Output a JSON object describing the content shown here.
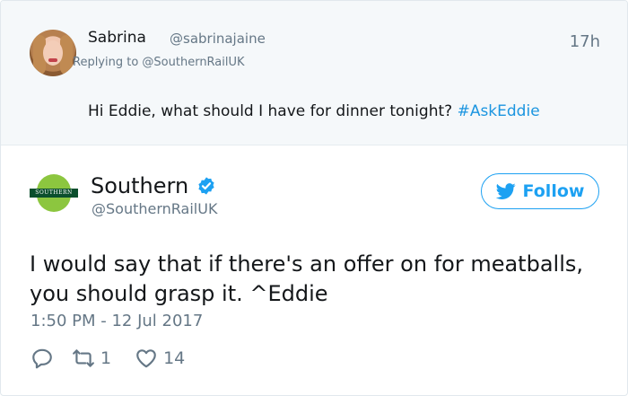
{
  "reply": {
    "name": "Sabrina",
    "handle": "@sabrinajaine",
    "time": "17h",
    "replying_to": "Replying to @SouthernRailUK",
    "text": "Hi Eddie, what should I have for dinner tonight?",
    "hashtag": "#AskEddie"
  },
  "tweet": {
    "logo_text": "SOUTHERN",
    "author_name": "Southern",
    "author_handle": "@SouthernRailUK",
    "follow_label": "Follow",
    "text": "I would say that if there's an offer on for meatballs, you should grasp it. ^Eddie",
    "timestamp": "1:50 PM - 12 Jul 2017",
    "retweet_count": "1",
    "like_count": "14"
  },
  "colors": {
    "accent": "#1da1f2",
    "hashtag": "#1b95e0",
    "muted": "#657786",
    "reply_bg": "#f5f8fa",
    "logo_green": "#8cc63f",
    "logo_dark": "#0b4f2d"
  },
  "icons": [
    "verified-badge-icon",
    "twitter-bird-icon",
    "reply-icon",
    "retweet-icon",
    "like-heart-icon"
  ]
}
